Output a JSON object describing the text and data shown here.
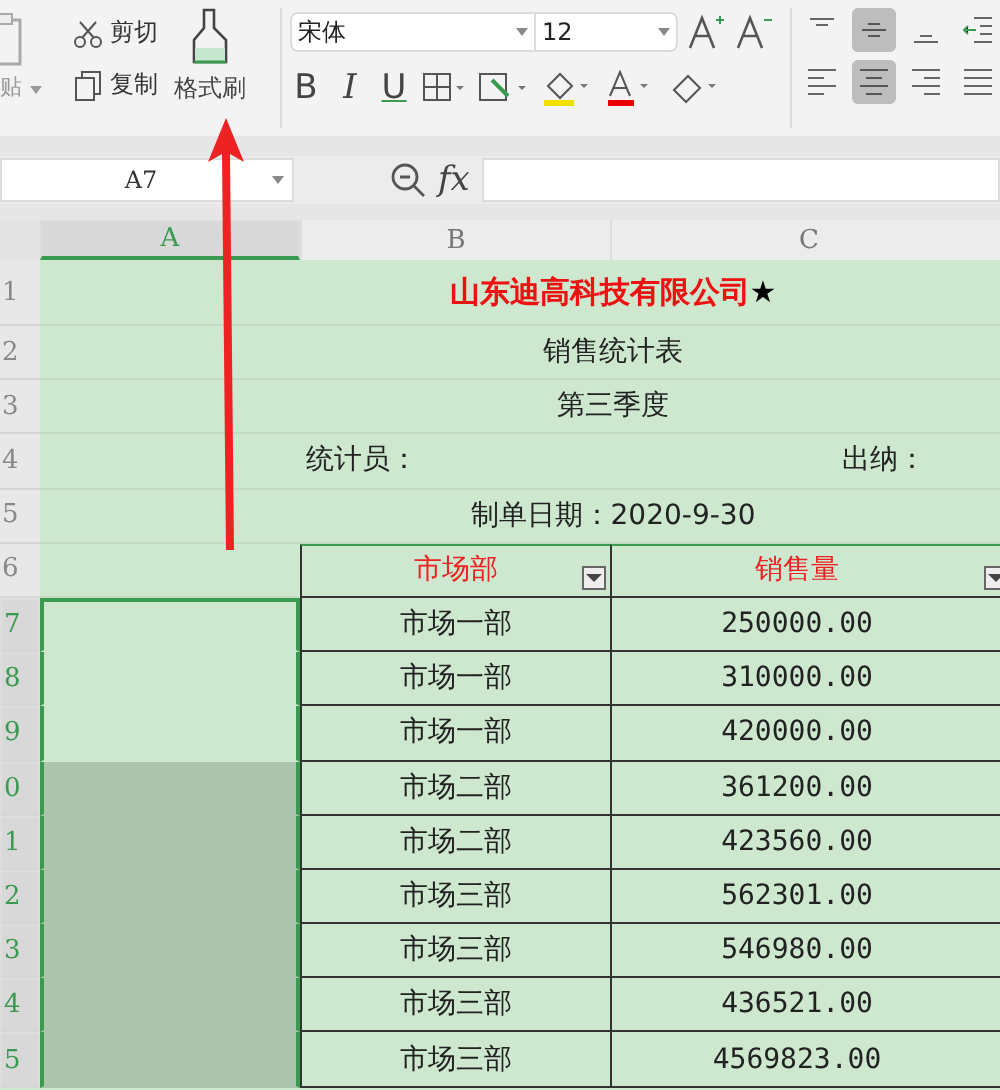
{
  "ribbon": {
    "paste": {
      "label": "贴"
    },
    "clip_actions": [
      {
        "kind": "cut",
        "label": "剪切"
      },
      {
        "kind": "copy",
        "label": "复制"
      }
    ],
    "brush": {
      "label": "格式刷"
    },
    "font_name": "宋体",
    "font_size": "12",
    "format_buttons": [
      "B",
      "I",
      "U"
    ],
    "align_rows": [
      [
        {
          "kind": "top",
          "selected": false
        },
        {
          "kind": "middle",
          "selected": true
        },
        {
          "kind": "bottom",
          "selected": false
        },
        {
          "kind": "indent",
          "selected": false
        }
      ],
      [
        {
          "kind": "left",
          "selected": false
        },
        {
          "kind": "center",
          "selected": true
        },
        {
          "kind": "right",
          "selected": false
        },
        {
          "kind": "justify",
          "selected": false
        }
      ]
    ]
  },
  "formula_bar": {
    "name_box": "A7",
    "fx": "fx"
  },
  "columns": [
    {
      "label": "A",
      "selected": true
    },
    {
      "label": "B",
      "selected": false
    },
    {
      "label": "C",
      "selected": false
    }
  ],
  "rows": [
    {
      "num": "1",
      "selected": false,
      "kind": "title",
      "text": "山东迪高科技有限公司",
      "mark": "★"
    },
    {
      "num": "2",
      "selected": false,
      "kind": "center",
      "text": "销售统计表"
    },
    {
      "num": "3",
      "selected": false,
      "kind": "center",
      "text": "第三季度"
    },
    {
      "num": "4",
      "selected": false,
      "kind": "split",
      "left": "统计员：",
      "right": "出纳："
    },
    {
      "num": "5",
      "selected": false,
      "kind": "center",
      "text": "制单日期：2020-9-30"
    },
    {
      "num": "6",
      "selected": false,
      "kind": "header",
      "b": "市场部",
      "c": "销售量"
    },
    {
      "num": "7",
      "selected": true,
      "shaded": false,
      "kind": "data",
      "b": "市场一部",
      "c": "250000.00"
    },
    {
      "num": "8",
      "selected": true,
      "shaded": false,
      "kind": "data",
      "b": "市场一部",
      "c": "310000.00"
    },
    {
      "num": "9",
      "selected": true,
      "shaded": false,
      "kind": "data",
      "b": "市场一部",
      "c": "420000.00"
    },
    {
      "num": "0",
      "selected": true,
      "shaded": true,
      "kind": "data",
      "b": "市场二部",
      "c": "361200.00"
    },
    {
      "num": "1",
      "selected": true,
      "shaded": true,
      "kind": "data",
      "b": "市场二部",
      "c": "423560.00"
    },
    {
      "num": "2",
      "selected": true,
      "shaded": true,
      "kind": "data",
      "b": "市场三部",
      "c": "562301.00"
    },
    {
      "num": "3",
      "selected": true,
      "shaded": true,
      "kind": "data",
      "b": "市场三部",
      "c": "546980.00"
    },
    {
      "num": "4",
      "selected": true,
      "shaded": true,
      "kind": "data",
      "b": "市场三部",
      "c": "436521.00"
    },
    {
      "num": "5",
      "selected": true,
      "shaded": true,
      "kind": "data",
      "b": "市场三部",
      "c": "4569823.00"
    }
  ]
}
